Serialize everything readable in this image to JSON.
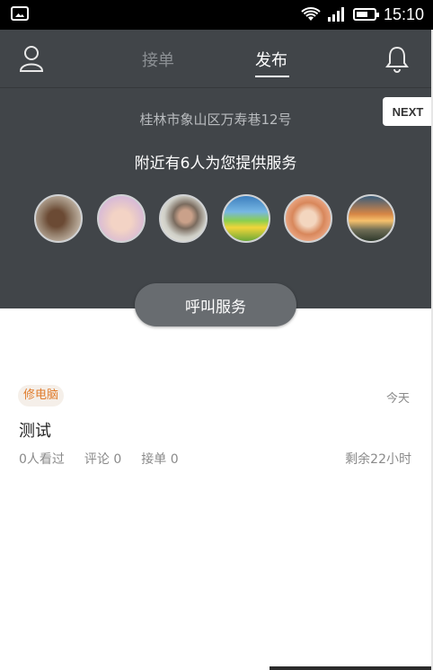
{
  "status_bar": {
    "time": "15:10",
    "left_icon": "image-notification-icon",
    "icons": [
      "wifi-icon",
      "signal-icon",
      "battery-icon"
    ]
  },
  "header": {
    "tabs": [
      {
        "label": "接单",
        "active": false
      },
      {
        "label": "发布",
        "active": true
      }
    ],
    "left_icon": "user-icon",
    "right_icon": "bell-icon"
  },
  "location": {
    "address": "桂林市象山区万寿巷12号"
  },
  "next_button": {
    "label": "NEXT"
  },
  "nearby": {
    "text": "附近有6人为您提供服务",
    "avatar_count": 6
  },
  "call_button": {
    "label": "呼叫服务"
  },
  "post": {
    "category": "修电脑",
    "date": "今天",
    "title": "测试",
    "views": "0人看过",
    "comments": "评论 0",
    "orders": "接单 0",
    "remaining": "剩余22小时"
  },
  "colors": {
    "panel": "#414549",
    "accent_orange": "#e07b2b",
    "call_button": "#686c70"
  }
}
